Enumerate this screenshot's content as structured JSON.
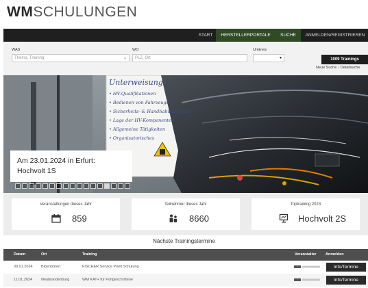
{
  "logo": {
    "bold": "WM",
    "light": "SCHULUNGEN"
  },
  "nav": {
    "items": [
      {
        "label": "START",
        "active": false
      },
      {
        "label": "HERSTELLERPORTALE",
        "active": true
      },
      {
        "label": "SUCHE",
        "active": true
      },
      {
        "label": "ANMELDEN/REGISTRIEREN",
        "active": false
      }
    ]
  },
  "search": {
    "was_label": "WAS",
    "was_value": "Thema, Training",
    "wo_label": "WO",
    "wo_placeholder": "PLZ, Ort",
    "umkreis_label": "Umkreis",
    "umkreis_value": "",
    "count_button": "1009 Trainings",
    "new_search": "Neue Suche",
    "detail_search": "Detailsuche"
  },
  "hero": {
    "caption_line1": "Am 23.01.2024 in Erfurt:",
    "caption_line2": "Hochvolt 1S",
    "whiteboard_lines": [
      "Unterweisung",
      "• HV-Qualifikationen",
      "• Bedienen von Fahrzeugen",
      "• Sicherheits- & Handhabungsregeln",
      "• Lage der HV-Komponenten",
      "• Allgemeine Tätigkeiten",
      "• Organisatorisches"
    ],
    "slide_count": 17,
    "active_slide": 13
  },
  "stats": [
    {
      "label": "Veranstaltungen dieses Jahr",
      "value": "859",
      "icon": "calendar-icon"
    },
    {
      "label": "Teilnehmer dieses Jahr",
      "value": "8660",
      "icon": "people-icon"
    },
    {
      "label": "Toptraining 2023",
      "value": "Hochvolt 2S",
      "icon": "presentation-icon"
    }
  ],
  "table": {
    "title": "Nächste Trainingstermine",
    "headers": [
      "Datum",
      "Ort",
      "Training",
      "Veranstalter",
      "Anmelden"
    ],
    "rows": [
      {
        "datum": "09.01.2024",
        "ort": "Bibenbüren",
        "training": "FISCHER Service Point Schulung",
        "button": "Info/Termine"
      },
      {
        "datum": "11.01.2024",
        "ort": "Neubrandenburg",
        "training": "WM KAT+ für Fortgeschrittene",
        "button": "Info/Termine"
      }
    ]
  },
  "colors": {
    "nav_bg": "#1f1f1f",
    "nav_active": "#2f4a24",
    "table_header": "#4e4e4e",
    "button_dark": "#2a2a2a"
  }
}
